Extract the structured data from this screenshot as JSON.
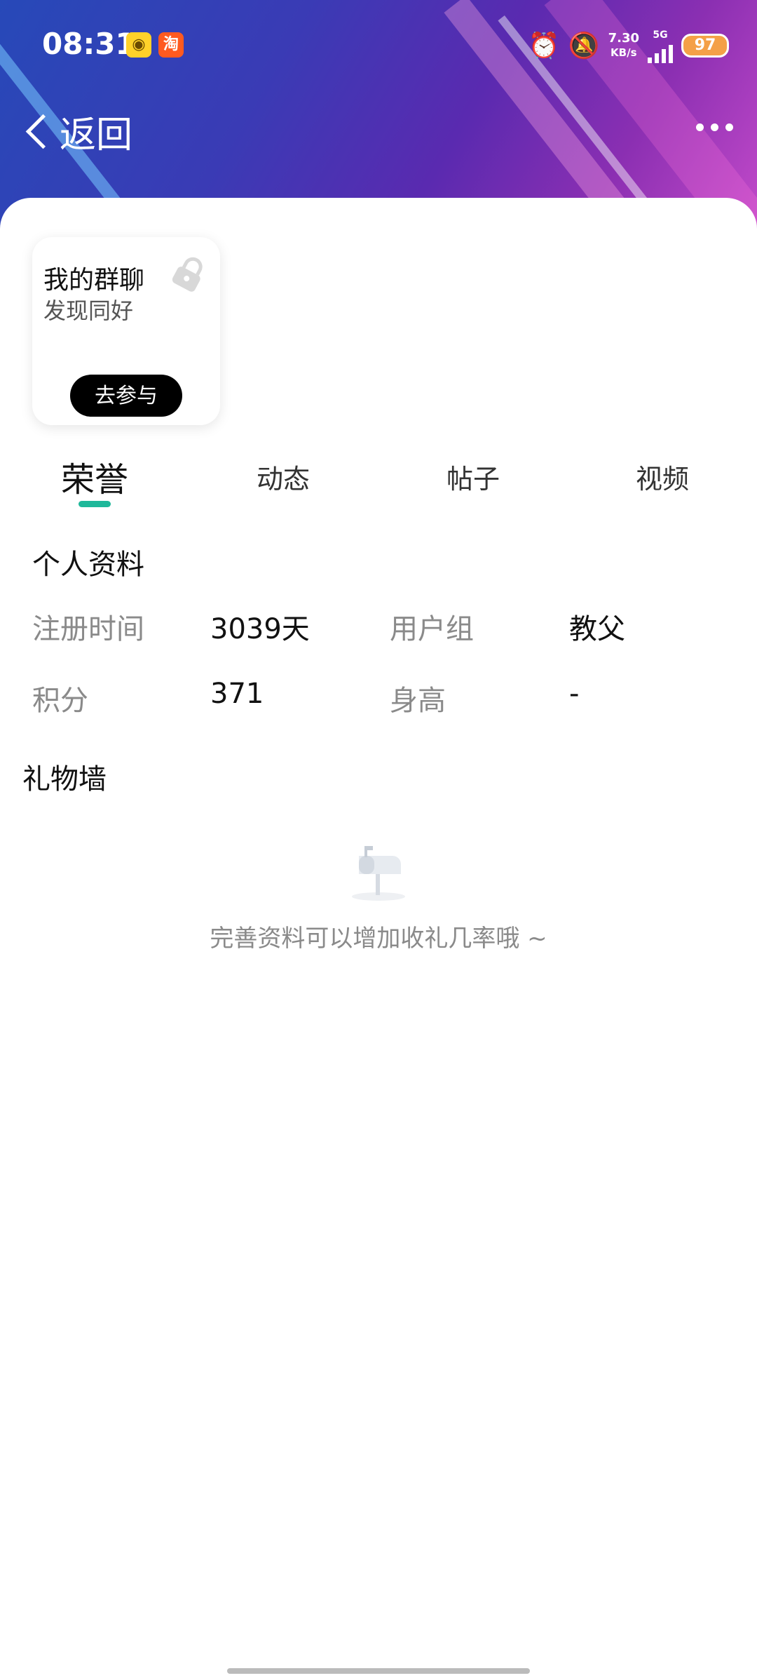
{
  "status_bar": {
    "time": "08:31",
    "app_icons": [
      "bilibili-style-app-icon",
      "taobao-app-icon"
    ],
    "taobao_icon_text": "淘",
    "network_speed": "7.30",
    "network_unit": "KB/s",
    "network_type": "5G",
    "battery": "97"
  },
  "nav": {
    "back_label": "返回",
    "more_icon": "more-dots-icon"
  },
  "group_card": {
    "title": "我的群聊",
    "subtitle": "发现同好",
    "button_label": "去参与",
    "lock_icon": "lock-icon"
  },
  "tabs": [
    {
      "label": "荣誉",
      "active": true
    },
    {
      "label": "动态",
      "active": false
    },
    {
      "label": "帖子",
      "active": false
    },
    {
      "label": "视频",
      "active": false
    }
  ],
  "profile": {
    "title": "个人资料",
    "rows": [
      {
        "label1": "注册时间",
        "value1": "3039天",
        "label2": "用户组",
        "value2": "教父"
      },
      {
        "label1": "积分",
        "value1": "371",
        "label2": "身高",
        "value2": "-"
      }
    ]
  },
  "gift_wall": {
    "title": "礼物墙",
    "empty_icon": "mailbox-icon",
    "empty_text": "完善资料可以增加收礼几率哦 ~"
  },
  "colors": {
    "accent": "#1fb89a",
    "header_start": "#2749b8",
    "header_end": "#c24ac9",
    "battery": "#f4a047"
  }
}
